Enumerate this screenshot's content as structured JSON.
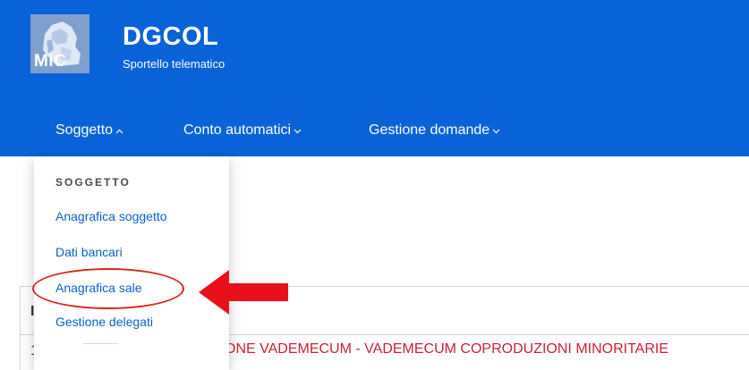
{
  "header": {
    "logo_text": "MiC",
    "title": "DGCOL",
    "subtitle": "Sportello telematico",
    "bg_color": "#0862d8"
  },
  "nav": {
    "items": [
      {
        "label": "Soggetto",
        "chevron": "up"
      },
      {
        "label": "Conto automatici",
        "chevron": "down"
      },
      {
        "label": "Gestione domande",
        "chevron": "down"
      }
    ]
  },
  "dropdown": {
    "heading": "SOGGETTO",
    "items": [
      {
        "label": "Anagrafica soggetto"
      },
      {
        "label": "Dati bancari"
      },
      {
        "label": "Anagrafica sale"
      },
      {
        "label": "Gestione delegati"
      }
    ],
    "highlight_color": "#d6281f"
  },
  "content": {
    "header_fragment": "I",
    "row_number_fragment": "1",
    "row_link": "ONE VADEMECUM - VADEMECUM COPRODUZIONI MINORITARIE",
    "row_link_color": "#c82333"
  }
}
